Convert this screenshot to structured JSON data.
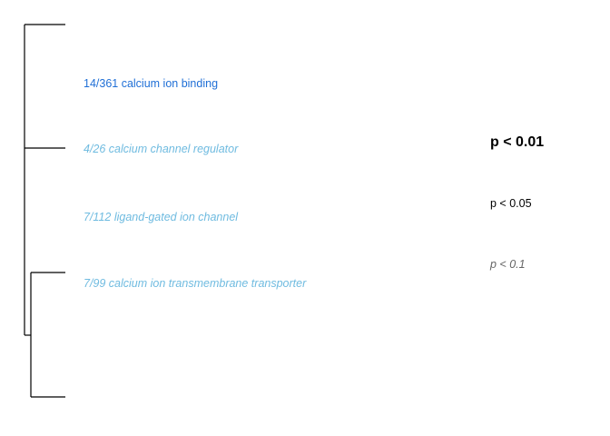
{
  "terms": [
    {
      "label": "14/361 calcium ion binding",
      "significance": "p < 0.01",
      "color": "#1f6fd6"
    },
    {
      "label": "4/26 calcium channel regulator",
      "significance": "p < 0.1",
      "color": "#6fbbe0"
    },
    {
      "label": "7/112 ligand-gated ion channel",
      "significance": "p < 0.1",
      "color": "#6fbbe0"
    },
    {
      "label": "7/99 calcium ion transmembrane transporter",
      "significance": "p < 0.1",
      "color": "#6fbbe0"
    }
  ],
  "legend": {
    "p001": "p < 0.01",
    "p005": "p < 0.05",
    "p01": "p < 0.1"
  },
  "colors": {
    "tree_line": "#000000",
    "legend_p01": "#666666"
  }
}
